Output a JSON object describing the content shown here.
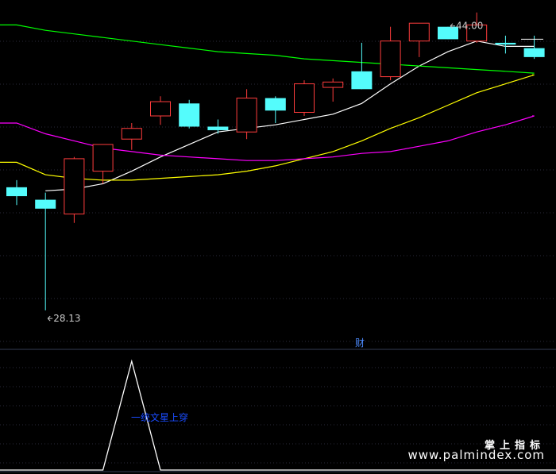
{
  "chart_data": {
    "type": "candlestick",
    "main_panel": {
      "ylim": [
        26,
        45.5
      ],
      "candles": [
        {
          "o": 35.0,
          "h": 35.4,
          "l": 34.0,
          "c": 34.5
        },
        {
          "o": 34.3,
          "h": 34.7,
          "l": 28.1,
          "c": 33.8
        },
        {
          "o": 33.5,
          "h": 36.7,
          "l": 33.0,
          "c": 36.6
        },
        {
          "o": 35.9,
          "h": 36.9,
          "l": 35.2,
          "c": 37.4
        },
        {
          "o": 37.7,
          "h": 38.6,
          "l": 37.1,
          "c": 38.3
        },
        {
          "o": 39.0,
          "h": 40.1,
          "l": 38.5,
          "c": 39.8
        },
        {
          "o": 39.7,
          "h": 39.9,
          "l": 38.3,
          "c": 38.4
        },
        {
          "o": 38.4,
          "h": 38.8,
          "l": 38.0,
          "c": 38.2
        },
        {
          "o": 38.1,
          "h": 40.5,
          "l": 37.7,
          "c": 40.0
        },
        {
          "o": 40.0,
          "h": 40.1,
          "l": 38.6,
          "c": 39.3
        },
        {
          "o": 39.2,
          "h": 41.0,
          "l": 39.0,
          "c": 40.8
        },
        {
          "o": 40.6,
          "h": 41.1,
          "l": 39.8,
          "c": 40.9
        },
        {
          "o": 41.5,
          "h": 43.1,
          "l": 40.6,
          "c": 40.5
        },
        {
          "o": 41.2,
          "h": 44.0,
          "l": 41.0,
          "c": 43.2
        },
        {
          "o": 43.2,
          "h": 44.2,
          "l": 42.3,
          "c": 44.2
        },
        {
          "o": 44.0,
          "h": 43.9,
          "l": 43.4,
          "c": 43.3
        },
        {
          "o": 43.2,
          "h": 44.8,
          "l": 43.1,
          "c": 44.1
        },
        {
          "o": 43.1,
          "h": 43.5,
          "l": 42.5,
          "c": 43.0
        },
        {
          "o": 42.8,
          "h": 43.5,
          "l": 42.2,
          "c": 42.3
        }
      ],
      "ma_lines": [
        {
          "color": "#ffffff",
          "values": [
            null,
            34.8,
            34.9,
            35.2,
            35.9,
            36.7,
            37.4,
            38.1,
            38.3,
            38.5,
            38.8,
            39.1,
            39.7,
            40.8,
            41.8,
            42.6,
            43.2,
            42.9,
            42.9
          ]
        },
        {
          "color": "#ffff00",
          "values": [
            36.4,
            35.7,
            35.5,
            35.4,
            35.4,
            35.5,
            35.6,
            35.7,
            35.9,
            36.2,
            36.6,
            37.0,
            37.6,
            38.3,
            38.9,
            39.6,
            40.3,
            40.8,
            41.3
          ]
        },
        {
          "color": "#ff00ff",
          "values": [
            38.6,
            38.0,
            37.6,
            37.2,
            37.0,
            36.8,
            36.7,
            36.6,
            36.5,
            36.5,
            36.6,
            36.7,
            36.9,
            37.0,
            37.3,
            37.6,
            38.1,
            38.5,
            39.0
          ]
        },
        {
          "color": "#00ff00",
          "values": [
            44.1,
            43.8,
            43.6,
            43.4,
            43.2,
            43.0,
            42.8,
            42.6,
            42.5,
            42.4,
            42.2,
            42.1,
            42.0,
            41.9,
            41.8,
            41.7,
            41.6,
            41.5,
            41.4
          ]
        }
      ],
      "annotations": [
        {
          "text": "44.00",
          "x_index": 15,
          "y": 44.0
        },
        {
          "text": "28.13",
          "x_index": 1,
          "y": 28.13
        }
      ],
      "colors": {
        "up": "#ff3c3c",
        "down": "#54fcfc"
      }
    },
    "lower_panel": {
      "ylim": [
        0,
        1
      ],
      "values": [
        0,
        0,
        0,
        0,
        1,
        0,
        0,
        0,
        0,
        0,
        0,
        0,
        0,
        0,
        0,
        0,
        0,
        0,
        0
      ],
      "label": "一统文星上穿",
      "label_color": "#1a4cff"
    },
    "divider_label": "财"
  },
  "watermark": {
    "line1": "掌上指标",
    "line2": "www.palmindex.com"
  }
}
